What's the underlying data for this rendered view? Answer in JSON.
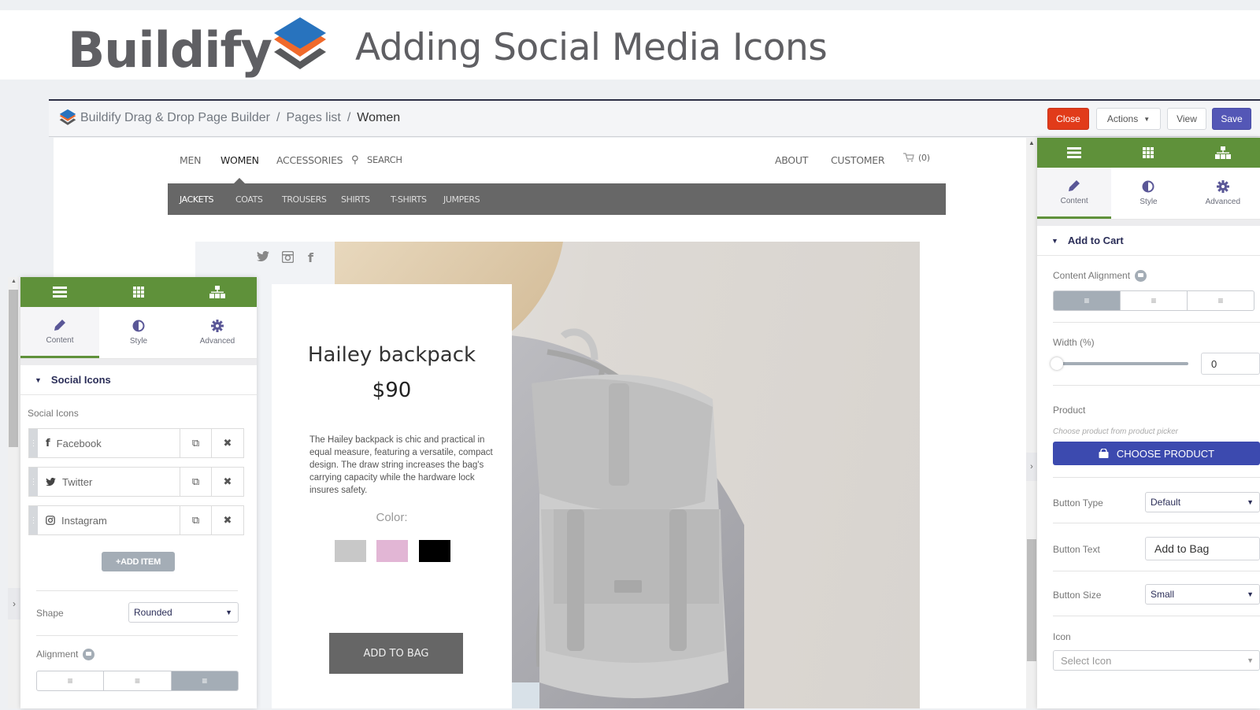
{
  "banner": {
    "brand": "Buildify",
    "title": "Adding Social Media Icons"
  },
  "appbar": {
    "breadcrumbs": [
      "Buildify Drag & Drop Page Builder",
      "Pages list",
      "Women"
    ],
    "separator": "/",
    "buttons": {
      "close": "Close",
      "actions": "Actions",
      "view": "View",
      "save": "Save"
    }
  },
  "colors": {
    "panel_green": "#5f913a",
    "close_red": "#e13b1a",
    "save_blue": "#5457b6",
    "choose_product_blue": "#3c4aaf",
    "swatches": [
      "#c8c8c8",
      "#e2b6d5",
      "#000000"
    ]
  },
  "site": {
    "nav_left": [
      "MEN",
      "WOMEN",
      "ACCESSORIES"
    ],
    "search_label": "SEARCH",
    "nav_right": [
      "ABOUT",
      "CUSTOMER"
    ],
    "cart_count": "(0)",
    "subnav": [
      "JACKETS",
      "COATS",
      "TROUSERS",
      "SHIRTS",
      "T-SHIRTS",
      "JUMPERS"
    ],
    "social_icons": [
      "twitter-icon",
      "instagram-icon",
      "facebook-icon"
    ]
  },
  "product": {
    "name": "Hailey backpack",
    "price": "$90",
    "description": "The Hailey backpack is chic and practical in equal measure, featuring a versatile, compact design. The draw string increases the bag's carrying capacity while the hardware lock insures safety.",
    "color_label": "Color:",
    "add_button": "ADD TO BAG"
  },
  "left_panel": {
    "tabs": [
      "Content",
      "Style",
      "Advanced"
    ],
    "section": "Social Icons",
    "field_label": "Social Icons",
    "items": [
      {
        "icon": "facebook-icon",
        "label": "Facebook"
      },
      {
        "icon": "twitter-icon",
        "label": "Twitter"
      },
      {
        "icon": "instagram-icon",
        "label": "Instagram"
      }
    ],
    "add_item": "+ADD ITEM",
    "shape_label": "Shape",
    "shape_value": "Rounded",
    "alignment_label": "Alignment",
    "alignment_selected": "right"
  },
  "right_panel": {
    "tabs": [
      "Content",
      "Style",
      "Advanced"
    ],
    "section": "Add to Cart",
    "content_alignment_label": "Content Alignment",
    "content_alignment_selected": "left",
    "width_label": "Width (%)",
    "width_value": "0",
    "product_label": "Product",
    "product_hint": "Choose product from product picker",
    "choose_product": "CHOOSE PRODUCT",
    "button_type_label": "Button Type",
    "button_type_value": "Default",
    "button_text_label": "Button Text",
    "button_text_value": "Add to Bag",
    "button_size_label": "Button Size",
    "button_size_value": "Small",
    "icon_label": "Icon",
    "icon_placeholder": "Select Icon"
  }
}
